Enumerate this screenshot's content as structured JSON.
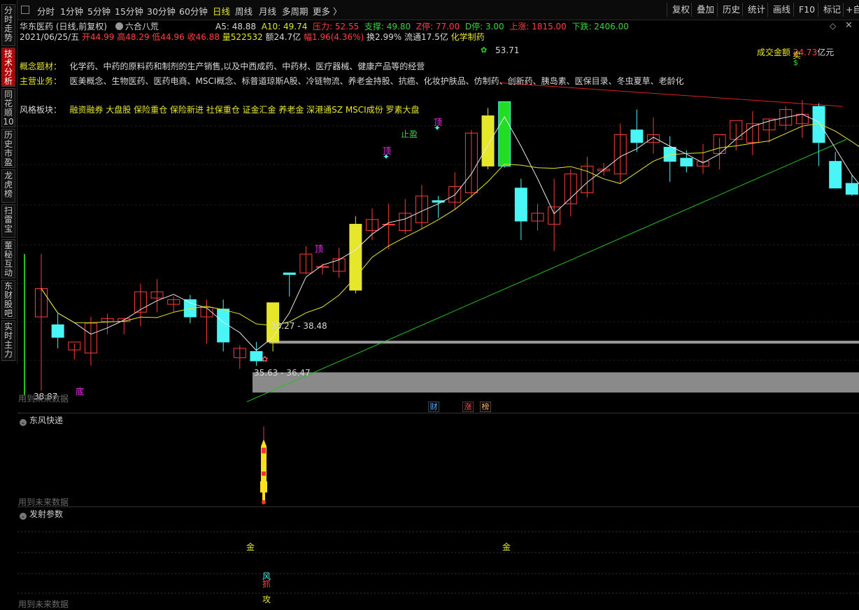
{
  "sidebar": {
    "tabs": [
      {
        "label": "分时走势",
        "active": false
      },
      {
        "label": "技术分析",
        "active": true
      },
      {
        "label": "同花顺10",
        "active": false
      },
      {
        "label": "历史市盈",
        "active": false
      },
      {
        "label": "龙虎榜",
        "active": false
      },
      {
        "label": "扫雷宝",
        "active": false
      },
      {
        "label": "董秘互动",
        "active": false
      },
      {
        "label": "东财股吧",
        "active": false
      },
      {
        "label": "实时主力",
        "active": false
      }
    ]
  },
  "toolbar": {
    "periods": [
      "分时",
      "1分钟",
      "5分钟",
      "15分钟",
      "30分钟",
      "60分钟",
      "日线",
      "周线",
      "月线",
      "多周期",
      "更多 〉"
    ],
    "selected_period": "日线",
    "right_buttons": [
      "复权",
      "叠加",
      "历史",
      "统计",
      "画线",
      "F10",
      "标记",
      "+自选"
    ]
  },
  "header": {
    "stock_title": "华东医药 (日线,前复权)",
    "strategy": "六合八荒",
    "a5": "A5: 48.88",
    "a10": "A10: 49.74",
    "resistance": "压力: 52.55",
    "support": "支撑: 49.80",
    "z_stop": "Z停: 77.00",
    "d_stop": "D停: 3.00",
    "up_count": "上涨: 1815.00",
    "down_count": "下跌: 2406.00"
  },
  "quote": {
    "date": "2021/06/25/五",
    "open": "开44.99",
    "high": "高48.29",
    "low": "低44.96",
    "close": "收46.88",
    "volume": "量522532",
    "amount": "额24.7亿",
    "change": "幅1.96(4.36%)",
    "turnover": "换2.99%",
    "float_cap": "流通17.5亿",
    "industry": "化学制药"
  },
  "info": {
    "concept_label": "概念题材：",
    "concept_text": "化学药、中药的原料药和制剂的生产销售,以及中西成药、中药材、医疗器械、健康产品等的经营",
    "business_label": "主营业务：",
    "business_text": "医美概念、生物医药、医药电商、MSCI概念、标普道琼斯A股、冷链物流、养老金持股、抗癌、化妆护肤品、仿制药、创新药、胰岛素、医保目录、冬虫夏草、老龄化",
    "sector_label": "风格板块：",
    "sector_text": "融资融券 大盘股 保险重仓 保险新进 社保重仓 证金汇金 养老金 深港通SZ MSCI成份 罗素大盘"
  },
  "chart_labels": {
    "amount_label": "成交金额",
    "amount_value": "24.73",
    "amount_unit": "亿元",
    "high_price": "53.71",
    "low_price": "38.87",
    "zone_upper": "38.27 - 38.48",
    "zone_lower": "35.63 - 36.47",
    "stop_profit": "止盈",
    "top1": "顶",
    "top2": "顶",
    "top3": "顶",
    "sell": "卖",
    "bottom": "底",
    "future_data": "用到未来数据",
    "event_cai": "财",
    "event_zhang": "涨",
    "event_bang": "榜"
  },
  "panels": {
    "panel2_title": "东风快递",
    "panel3_title": "发射参数",
    "future_data": "用到未来数据",
    "jin1": "金",
    "jin2": "金",
    "feng": "风",
    "zhua": "抓",
    "gong": "攻"
  },
  "colors": {
    "up": "#ff3b3b",
    "down": "#49f5f5",
    "yellow": "#e6e62a",
    "green_line": "#22c022",
    "highlight_green": "#22dd22"
  },
  "chart_data": {
    "type": "candlestick",
    "price_range": [
      33.9,
      57.5
    ],
    "high_marker": 53.71,
    "low_marker": 38.87,
    "candles": [
      {
        "o": 40.0,
        "h": 44.0,
        "l": 35.3,
        "c": 41.8
      },
      {
        "o": 39.5,
        "h": 40.2,
        "l": 38.0,
        "c": 38.7
      },
      {
        "o": 37.9,
        "h": 38.3,
        "l": 37.3,
        "c": 38.4
      },
      {
        "o": 37.7,
        "h": 40.0,
        "l": 36.9,
        "c": 39.6
      },
      {
        "o": 39.7,
        "h": 40.2,
        "l": 38.9,
        "c": 39.9
      },
      {
        "o": 39.7,
        "h": 39.9,
        "l": 38.9,
        "c": 39.9
      },
      {
        "o": 40.3,
        "h": 42.1,
        "l": 39.4,
        "c": 41.6
      },
      {
        "o": 41.2,
        "h": 42.4,
        "l": 40.3,
        "c": 41.6
      },
      {
        "o": 40.8,
        "h": 41.3,
        "l": 40.3,
        "c": 41.1
      },
      {
        "o": 41.1,
        "h": 41.4,
        "l": 39.6,
        "c": 40.0
      },
      {
        "o": 40.0,
        "h": 41.1,
        "l": 38.3,
        "c": 40.6
      },
      {
        "o": 40.5,
        "h": 41.1,
        "l": 37.8,
        "c": 38.4
      },
      {
        "o": 37.4,
        "h": 38.2,
        "l": 36.7,
        "c": 38.0
      },
      {
        "o": 37.8,
        "h": 38.4,
        "l": 36.9,
        "c": 37.2
      },
      {
        "o": 38.4,
        "h": 40.9,
        "l": 37.8,
        "c": 40.9
      },
      {
        "o": 42.8,
        "h": 42.8,
        "l": 41.3,
        "c": 42.7
      },
      {
        "o": 42.8,
        "h": 44.5,
        "l": 42.7,
        "c": 44.0
      },
      {
        "o": 43.2,
        "h": 43.4,
        "l": 42.7,
        "c": 43.2
      },
      {
        "o": 42.9,
        "h": 44.4,
        "l": 42.5,
        "c": 43.7
      },
      {
        "o": 41.7,
        "h": 46.4,
        "l": 41.5,
        "c": 45.9
      },
      {
        "o": 45.5,
        "h": 46.9,
        "l": 44.9,
        "c": 46.2
      },
      {
        "o": 45.9,
        "h": 47.2,
        "l": 44.3,
        "c": 45.9
      },
      {
        "o": 45.5,
        "h": 47.5,
        "l": 45.3,
        "c": 46.6
      },
      {
        "o": 46.0,
        "h": 48.4,
        "l": 45.6,
        "c": 47.7
      },
      {
        "o": 47.4,
        "h": 47.7,
        "l": 46.3,
        "c": 47.3
      },
      {
        "o": 47.3,
        "h": 49.2,
        "l": 46.8,
        "c": 48.3
      },
      {
        "o": 47.9,
        "h": 51.9,
        "l": 47.6,
        "c": 51.7
      },
      {
        "o": 49.6,
        "h": 53.3,
        "l": 49.4,
        "c": 52.8
      },
      {
        "o": 49.6,
        "h": 53.7,
        "l": 49.5,
        "c": 53.7
      },
      {
        "o": 48.2,
        "h": 48.8,
        "l": 44.9,
        "c": 46.1
      },
      {
        "o": 46.1,
        "h": 47.2,
        "l": 45.5,
        "c": 46.6
      },
      {
        "o": 45.9,
        "h": 48.8,
        "l": 44.2,
        "c": 47.0
      },
      {
        "o": 47.2,
        "h": 49.4,
        "l": 46.4,
        "c": 49.1
      },
      {
        "o": 47.9,
        "h": 50.2,
        "l": 47.6,
        "c": 49.6
      },
      {
        "o": 49.3,
        "h": 49.8,
        "l": 49.0,
        "c": 49.4
      },
      {
        "o": 49.1,
        "h": 52.3,
        "l": 48.5,
        "c": 51.6
      },
      {
        "o": 51.9,
        "h": 53.2,
        "l": 50.5,
        "c": 51.1
      },
      {
        "o": 51.1,
        "h": 52.7,
        "l": 50.4,
        "c": 51.6
      },
      {
        "o": 50.8,
        "h": 51.5,
        "l": 48.6,
        "c": 49.9
      },
      {
        "o": 50.1,
        "h": 50.6,
        "l": 49.2,
        "c": 49.6
      },
      {
        "o": 49.6,
        "h": 51.0,
        "l": 49.1,
        "c": 49.9
      },
      {
        "o": 50.4,
        "h": 51.4,
        "l": 49.4,
        "c": 51.6
      },
      {
        "o": 51.3,
        "h": 52.3,
        "l": 50.6,
        "c": 52.5
      },
      {
        "o": 51.1,
        "h": 53.1,
        "l": 50.3,
        "c": 52.3
      },
      {
        "o": 51.9,
        "h": 52.6,
        "l": 51.1,
        "c": 52.6
      },
      {
        "o": 52.2,
        "h": 53.4,
        "l": 51.9,
        "c": 53.2
      },
      {
        "o": 52.3,
        "h": 53.8,
        "l": 51.4,
        "c": 52.9
      },
      {
        "o": 53.4,
        "h": 53.6,
        "l": 49.6,
        "c": 51.1
      },
      {
        "o": 49.9,
        "h": 50.5,
        "l": 48.4,
        "c": 48.2
      },
      {
        "o": 48.5,
        "h": 49.0,
        "l": 47.7,
        "c": 47.8
      },
      {
        "o": 47.6,
        "h": 48.0,
        "l": 46.9,
        "c": 47.2
      }
    ],
    "highlight_candles": {
      "yellow": [
        14,
        19,
        27
      ],
      "green": [
        28
      ]
    },
    "ma_short_label": "A5",
    "ma_long_label": "A10"
  }
}
